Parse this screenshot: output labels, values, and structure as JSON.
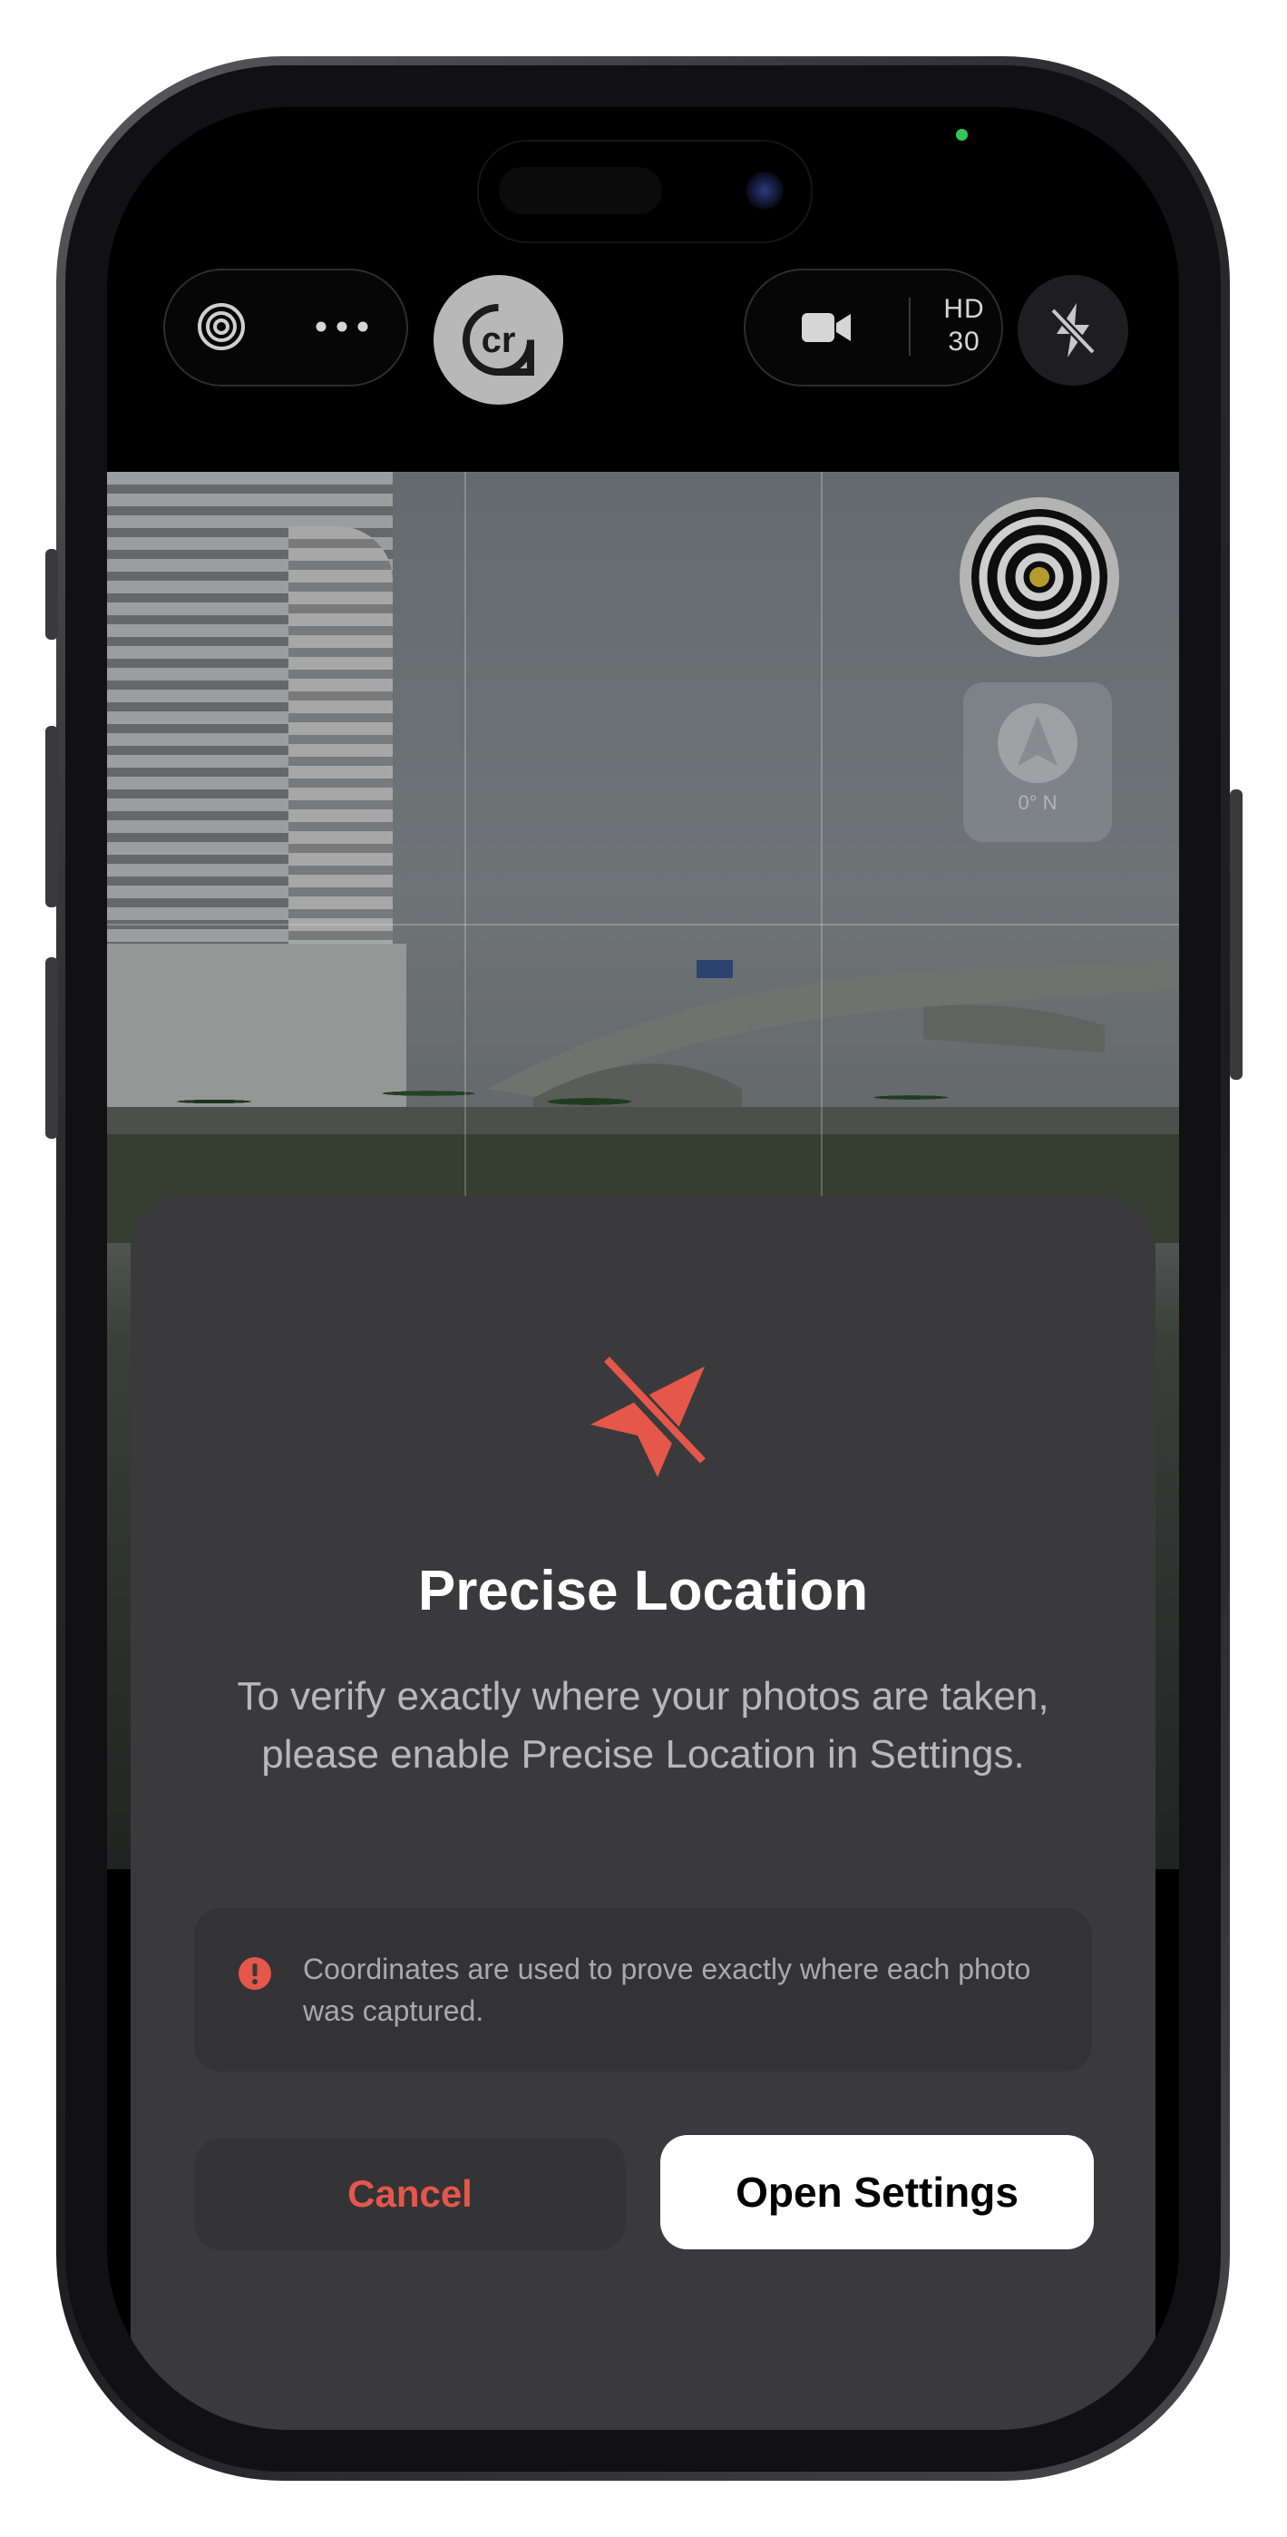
{
  "camera_toolbar": {
    "mode_icon": "target-icon",
    "more_icon": "ellipsis-icon",
    "app_logo_text": "cr",
    "video_icon": "video-camera-icon",
    "video_quality": "HD",
    "frame_rate": "30",
    "flash_icon": "flash-off-icon"
  },
  "viewfinder": {
    "compass_label": "0° N",
    "target_icon": "target-icon",
    "compass_icon": "location-arrow-icon"
  },
  "dialog": {
    "icon": "location-slash-icon",
    "title": "Precise Location",
    "body": "To verify exactly where your photos are taken, please enable Precise Location in Settings.",
    "info_icon": "alert-circle-icon",
    "info_text": "Coordinates are used to prove exactly where each photo was captured.",
    "cancel_label": "Cancel",
    "open_settings_label": "Open Settings"
  },
  "colors": {
    "accent_red": "#e5574a",
    "sheet_background": "#3a3a3c",
    "primary_button": "#ffffff"
  }
}
